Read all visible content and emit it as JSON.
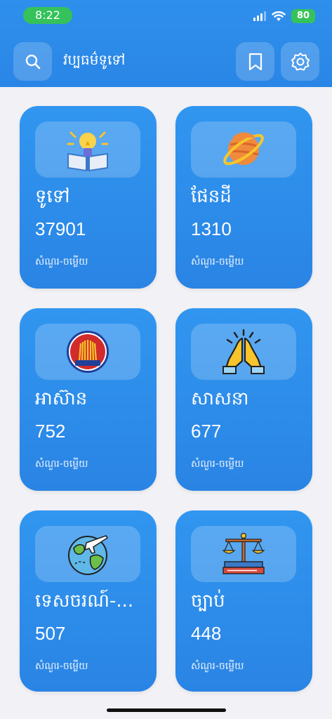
{
  "status": {
    "time": "8:22",
    "battery": "80"
  },
  "header": {
    "title": "វប្បធម៌ទូទៅ",
    "search_icon": "search-icon",
    "bookmark_icon": "bookmark-icon",
    "settings_icon": "gear-icon"
  },
  "colors": {
    "header": "#2f8fec",
    "card": "#3196f0",
    "status_green": "#35c25a",
    "background": "#f2f2f6"
  },
  "categories": [
    {
      "name": "ទូទៅ",
      "count": "37901",
      "label": "សំណួរ-ចម្លើយ",
      "icon": "lightbulb-book-icon"
    },
    {
      "name": "ផែនដី",
      "count": "1310",
      "label": "សំណួរ-ចម្លើយ",
      "icon": "planet-icon"
    },
    {
      "name": "អាស៊ាន",
      "count": "752",
      "label": "សំណួរ-ចម្លើយ",
      "icon": "asean-emblem-icon"
    },
    {
      "name": "សាសនា",
      "count": "677",
      "label": "សំណួរ-ចម្លើយ",
      "icon": "praying-hands-icon"
    },
    {
      "name": "ទេសចរណ៍-...",
      "count": "507",
      "label": "សំណួរ-ចម្លើយ",
      "icon": "globe-airplane-icon"
    },
    {
      "name": "ច្បាប់",
      "count": "448",
      "label": "សំណួរ-ចម្លើយ",
      "icon": "scales-of-justice-icon"
    }
  ]
}
